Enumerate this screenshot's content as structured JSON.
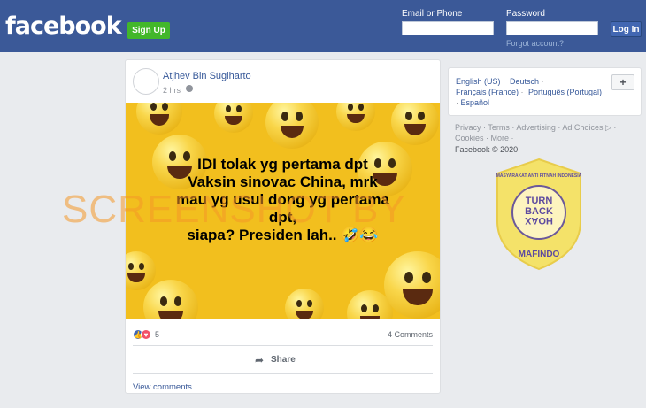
{
  "header": {
    "logo": "facebook",
    "signup_label": "Sign Up",
    "email_label": "Email or Phone",
    "password_label": "Password",
    "login_label": "Log In",
    "forgot_label": "Forgot account?"
  },
  "post": {
    "author": "Atjhev Bin Sugiharto",
    "time": "2 hrs",
    "text_lines": [
      "IDI tolak yg pertama dpt",
      "Vaksin sinovac China, mrk",
      "mau yg usul dong yg pertama",
      "dpt,",
      "siapa? Presiden lah.. 🤣😂"
    ],
    "reactions_count": "5",
    "comments_label": "4 Comments",
    "share_label": "Share",
    "view_comments_label": "View comments"
  },
  "sidebar": {
    "languages": [
      "English (US)",
      "Deutsch",
      "Français (France)",
      "Português (Portugal)",
      "Español"
    ],
    "footer_links": [
      "Privacy",
      "Terms",
      "Advertising",
      "Ad Choices",
      "Cookies",
      "More"
    ],
    "copyright": "Facebook © 2020"
  },
  "overlay": {
    "watermark": "SCREENSHOT BY",
    "badge_top": "MASYARAKAT ANTI FITNAH INDONESIA",
    "badge_center": [
      "TURN",
      "BACK",
      "HOAX"
    ],
    "badge_bottom": "MAFINDO"
  },
  "colors": {
    "fb_blue": "#3b5998",
    "signup_green": "#42b72a",
    "post_bg": "#f2bf1e",
    "watermark": "#f49828",
    "badge_yellow": "#f6e25b",
    "badge_purple": "#5d4aa0"
  }
}
